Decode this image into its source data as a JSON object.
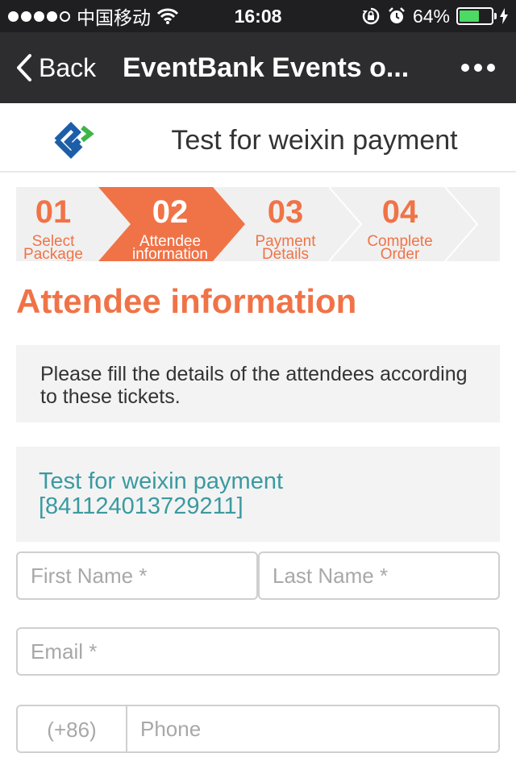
{
  "status_bar": {
    "carrier": "中国移动",
    "time": "16:08",
    "battery": "64%",
    "battery_level": 0.64
  },
  "nav": {
    "back_label": "Back",
    "title": "EventBank Events o..."
  },
  "event": {
    "title": "Test for weixin payment"
  },
  "steps": [
    {
      "num": "01",
      "line1": "Select",
      "line2": "Package"
    },
    {
      "num": "02",
      "line1": "Attendee",
      "line2": "information"
    },
    {
      "num": "03",
      "line1": "Payment",
      "line2": "Details"
    },
    {
      "num": "04",
      "line1": "Complete",
      "line2": "Order"
    }
  ],
  "section": {
    "title": "Attendee information",
    "notice": "Please fill the details of the attendees according to these tickets."
  },
  "ticket": {
    "name": "Test for weixin payment",
    "code": "[841124013729211]"
  },
  "form": {
    "first_name_placeholder": "First Name *",
    "last_name_placeholder": "Last Name *",
    "email_placeholder": "Email *",
    "phone_prefix": "(+86)",
    "phone_placeholder": "Phone"
  },
  "colors": {
    "accent": "#f07347",
    "ticket_text": "#3a9aa0",
    "navbar": "#2d2d30",
    "battery_fill": "#4cd964"
  }
}
